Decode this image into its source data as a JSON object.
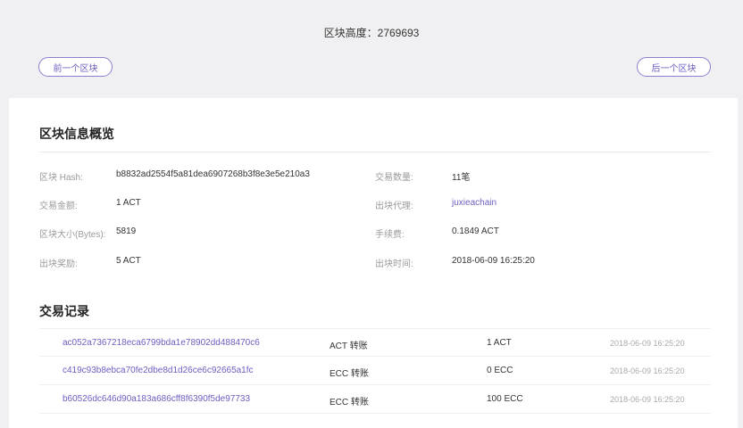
{
  "header": {
    "block_height_label": "区块高度：",
    "block_height_value": "2769693",
    "prev_button": "前一个区块",
    "next_button": "后一个区块"
  },
  "overview": {
    "title": "区块信息概览",
    "fields": {
      "hash_label": "区块 Hash:",
      "hash_value": "b8832ad2554f5a81dea6907268b3f8e3e5e210a3",
      "tx_count_label": "交易数量:",
      "tx_count_value": "11笔",
      "amount_label": "交易金额:",
      "amount_value": "1 ACT",
      "producer_label": "出块代理:",
      "producer_value": "juxieachain",
      "size_label": "区块大小(Bytes):",
      "size_value": "5819",
      "fee_label": "手续费:",
      "fee_value": "0.1849 ACT",
      "reward_label": "出块奖励:",
      "reward_value": "5 ACT",
      "time_label": "出块时间:",
      "time_value": "2018-06-09 16:25:20"
    }
  },
  "transactions": {
    "title": "交易记录",
    "rows": [
      {
        "hash": "ac052a7367218eca6799bda1e78902dd488470c6",
        "type": "ACT 转账",
        "amount": "1 ACT",
        "time": "2018-06-09 16:25:20"
      },
      {
        "hash": "c419c93b8ebca70fe2dbe8d1d26ce6c92665a1fc",
        "type": "ECC 转账",
        "amount": "0 ECC",
        "time": "2018-06-09 16:25:20"
      },
      {
        "hash": "b60526dc646d90a183a686cff8f6390f5de97733",
        "type": "ECC 转账",
        "amount": "100 ECC",
        "time": "2018-06-09 16:25:20"
      }
    ]
  },
  "colors": {
    "accent": "#6b5fc0",
    "background": "#f0f0f2"
  }
}
